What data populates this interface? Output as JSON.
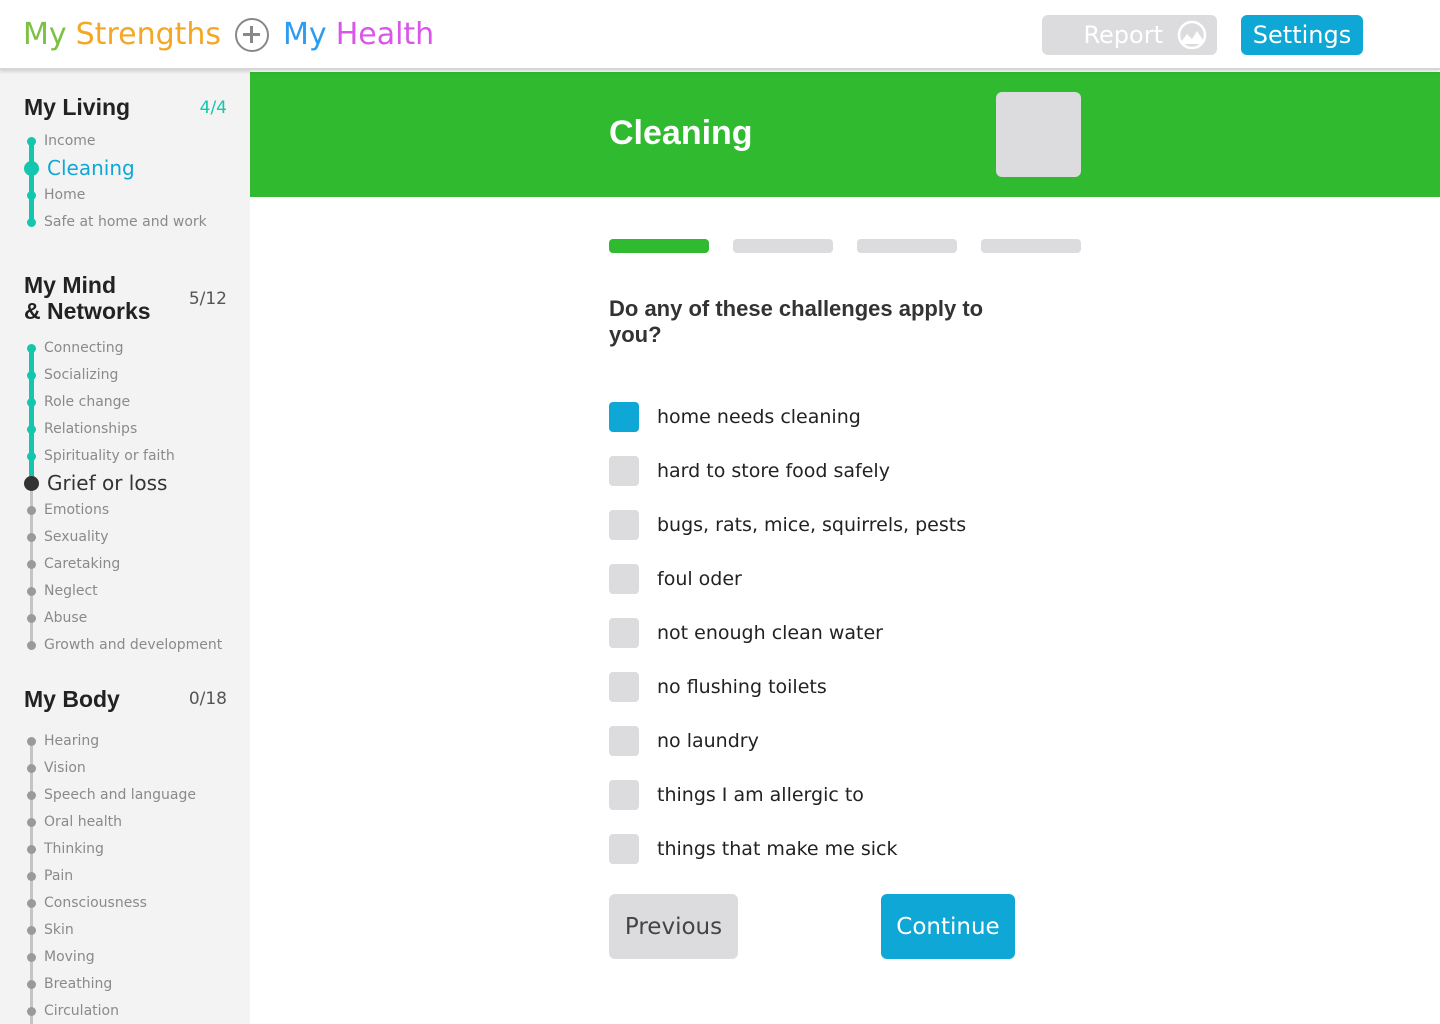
{
  "header": {
    "brand": {
      "word1": "My",
      "word2": "Strengths",
      "word3": "My",
      "word4": "Health",
      "colors": {
        "word1": "#7cc142",
        "word2": "#f5a623",
        "word3": "#2d9cf0",
        "word4": "#d957e8"
      }
    },
    "report_label": "Report",
    "settings_label": "Settings"
  },
  "sidebar": {
    "sections": [
      {
        "title": "My Living",
        "count": "4/4",
        "items": [
          {
            "label": "Income",
            "state": "done"
          },
          {
            "label": "Cleaning",
            "state": "current"
          },
          {
            "label": "Home",
            "state": "done"
          },
          {
            "label": "Safe at home and work",
            "state": "done"
          }
        ]
      },
      {
        "title_line1": "My Mind",
        "title_line2": "& Networks",
        "count": "5/12",
        "items": [
          {
            "label": "Connecting",
            "state": "done"
          },
          {
            "label": "Socializing",
            "state": "done"
          },
          {
            "label": "Role change",
            "state": "done"
          },
          {
            "label": "Relationships",
            "state": "done"
          },
          {
            "label": "Spirituality or faith",
            "state": "done"
          },
          {
            "label": "Grief or loss",
            "state": "current"
          },
          {
            "label": "Emotions",
            "state": "todo"
          },
          {
            "label": "Sexuality",
            "state": "todo"
          },
          {
            "label": "Caretaking",
            "state": "todo"
          },
          {
            "label": "Neglect",
            "state": "todo"
          },
          {
            "label": "Abuse",
            "state": "todo"
          },
          {
            "label": "Growth and development",
            "state": "todo"
          }
        ]
      },
      {
        "title": "My Body",
        "count": "0/18",
        "items": [
          {
            "label": "Hearing",
            "state": "todo"
          },
          {
            "label": "Vision",
            "state": "todo"
          },
          {
            "label": "Speech and language",
            "state": "todo"
          },
          {
            "label": "Oral health",
            "state": "todo"
          },
          {
            "label": "Thinking",
            "state": "todo"
          },
          {
            "label": "Pain",
            "state": "todo"
          },
          {
            "label": "Consciousness",
            "state": "todo"
          },
          {
            "label": "Skin",
            "state": "todo"
          },
          {
            "label": "Moving",
            "state": "todo"
          },
          {
            "label": "Breathing",
            "state": "todo"
          },
          {
            "label": "Circulation",
            "state": "todo"
          }
        ]
      }
    ]
  },
  "main": {
    "title": "Cleaning",
    "progress": {
      "current_step": 1,
      "total_steps": 4
    },
    "question": "Do any of these challenges apply to you?",
    "options": [
      {
        "label": "home needs cleaning",
        "checked": true
      },
      {
        "label": "hard to store food safely",
        "checked": false
      },
      {
        "label": "bugs, rats, mice, squirrels, pests",
        "checked": false
      },
      {
        "label": "foul oder",
        "checked": false
      },
      {
        "label": "not enough clean water",
        "checked": false
      },
      {
        "label": "no flushing toilets",
        "checked": false
      },
      {
        "label": "no laundry",
        "checked": false
      },
      {
        "label": "things I am allergic to",
        "checked": false
      },
      {
        "label": "things that make me sick",
        "checked": false
      }
    ],
    "previous_label": "Previous",
    "continue_label": "Continue"
  },
  "colors": {
    "accent_blue": "#0fa8d6",
    "banner_green": "#30ba2f",
    "done_teal": "#14c6ad",
    "inactive_gray": "#dcdcdf"
  }
}
